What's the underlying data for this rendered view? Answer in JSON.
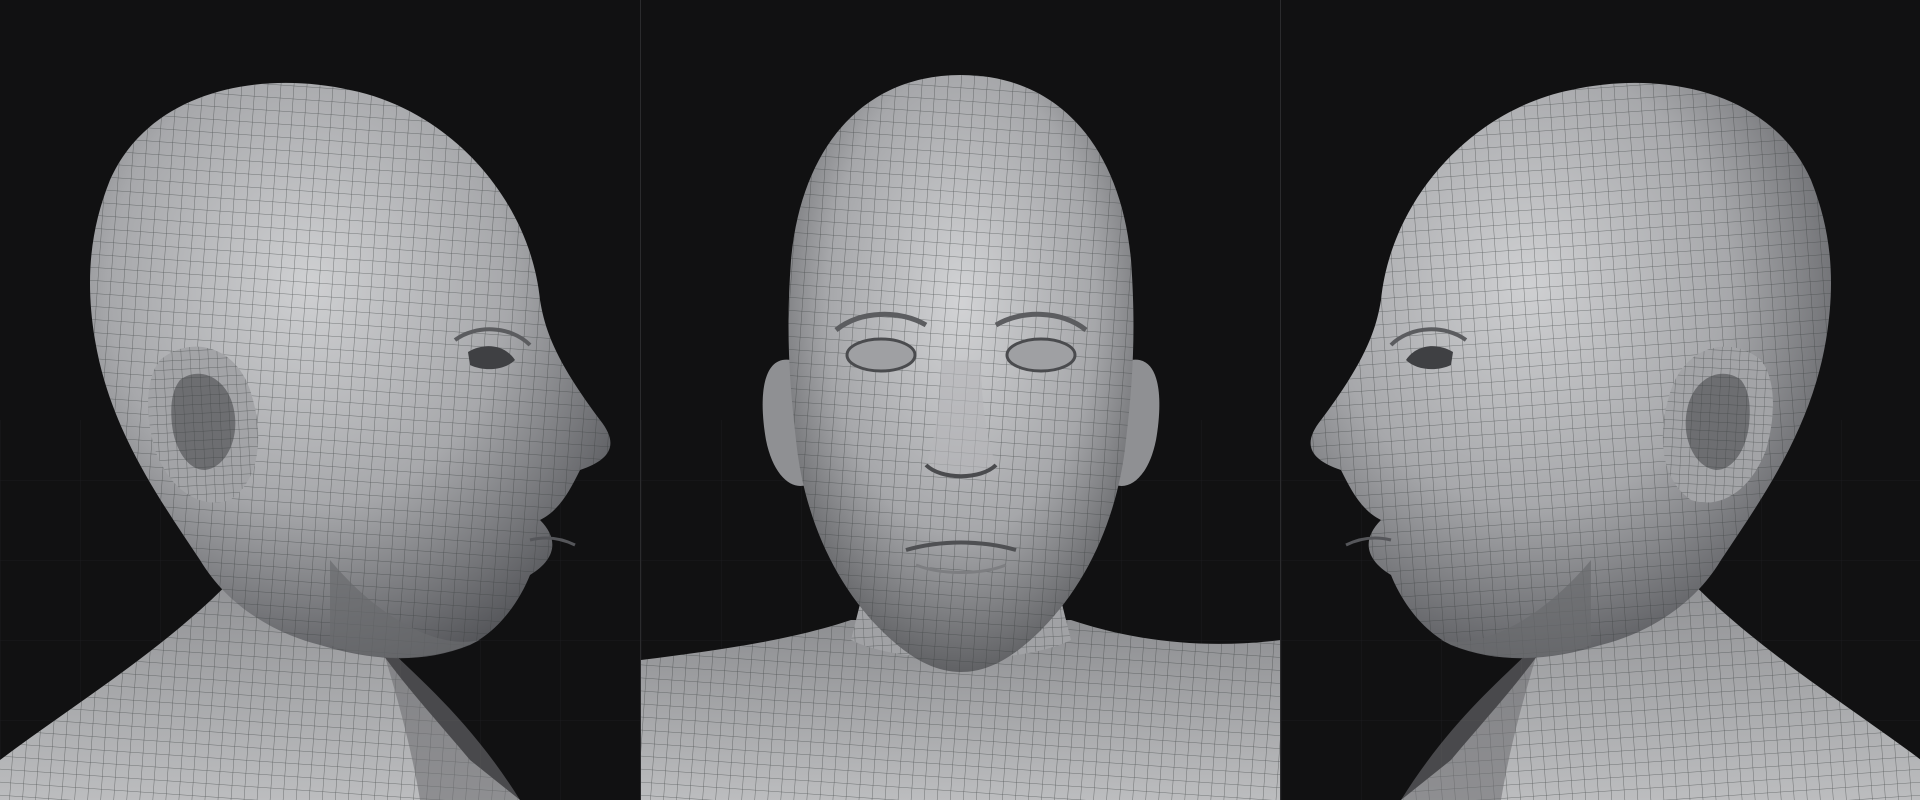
{
  "image": {
    "kind": "3d-wireframe-head-turnaround",
    "views": [
      {
        "id": "view-right-profile",
        "facing": "right"
      },
      {
        "id": "view-front",
        "facing": "front"
      },
      {
        "id": "view-left-profile",
        "facing": "left"
      }
    ],
    "colors": {
      "background": "#111112",
      "floor_grid": "#242427",
      "skin_light": "#c9cacc",
      "skin_mid": "#9c9da0",
      "skin_dark": "#4e4f52",
      "wire": "#3b3e3f",
      "divider": "#2b2b2d"
    }
  }
}
